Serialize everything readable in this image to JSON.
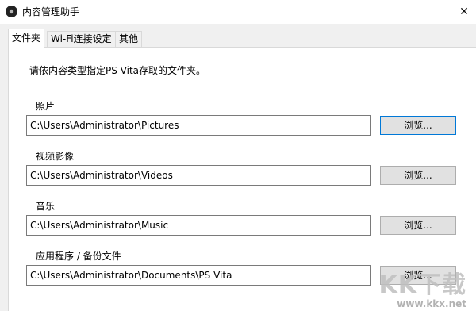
{
  "window": {
    "title": "内容管理助手",
    "close_symbol": "✕"
  },
  "tabs": [
    {
      "label": "文件夹",
      "active": true
    },
    {
      "label": "Wi-Fi连接设定",
      "active": false
    },
    {
      "label": "其他",
      "active": false
    }
  ],
  "instruction": "请依内容类型指定PS Vita存取的文件夹。",
  "sections": [
    {
      "label": "照片",
      "path": "C:\\Users\\Administrator\\Pictures",
      "button": "浏览..."
    },
    {
      "label": "视频影像",
      "path": "C:\\Users\\Administrator\\Videos",
      "button": "浏览..."
    },
    {
      "label": "音乐",
      "path": "C:\\Users\\Administrator\\Music",
      "button": "浏览..."
    },
    {
      "label": "应用程序 / 备份文件",
      "path": "C:\\Users\\Administrator\\Documents\\PS Vita",
      "button": "浏览..."
    }
  ],
  "watermark": {
    "logo": "KK下载",
    "url": "www.kkx.net"
  }
}
